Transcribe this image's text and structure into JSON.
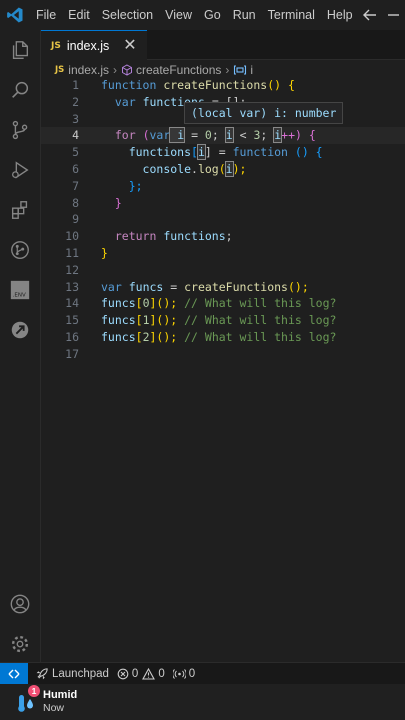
{
  "menu": [
    "File",
    "Edit",
    "Selection",
    "View",
    "Go",
    "Run",
    "Terminal",
    "Help"
  ],
  "tab": {
    "badge": "JS",
    "label": "index.js",
    "close": "✕"
  },
  "breadcrumb": {
    "file": "index.js",
    "func": "createFunctions",
    "var": "i",
    "sep": "›"
  },
  "hover": {
    "text": "(local var) i: number"
  },
  "line_numbers": [
    "1",
    "2",
    "3",
    "4",
    "5",
    "6",
    "7",
    "8",
    "9",
    "10",
    "11",
    "12",
    "13",
    "14",
    "15",
    "16",
    "17"
  ],
  "code": {
    "l1": {
      "kw": "function",
      "fn": "createFunctions",
      "rest": "() {"
    },
    "l2": {
      "kw": "var",
      "var": "functions",
      "rest": " = [];"
    },
    "l4": {
      "kw": "for",
      "a": " (",
      "kw2": "var",
      "v": " i",
      "b": " = ",
      "n0": "0",
      "c": "; ",
      "v2": "i",
      "d": " < ",
      "n3": "3",
      "e": "; ",
      "v3": "i",
      "f": "++) {"
    },
    "l5": {
      "var": "functions",
      "a": "[",
      "v": "i",
      "b": "] = ",
      "kw": "function",
      "c": " () {"
    },
    "l6": {
      "var": "console",
      "a": ".",
      "fn": "log",
      "b": "(",
      "v": "i",
      "c": ");"
    },
    "l7": "};",
    "l8": "}",
    "l10": {
      "kw": "return",
      "var": "functions",
      "rest": ";"
    },
    "l11": "}",
    "l13": {
      "kw": "var",
      "var": "funcs",
      "b": " = ",
      "fn": "createFunctions",
      "c": "();"
    },
    "l14": {
      "var": "funcs",
      "a": "[",
      "n": "0",
      "b": "](); ",
      "cmt": "// What will this log?"
    },
    "l15": {
      "var": "funcs",
      "a": "[",
      "n": "1",
      "b": "](); ",
      "cmt": "// What will this log?"
    },
    "l16": {
      "var": "funcs",
      "a": "[",
      "n": "2",
      "b": "](); ",
      "cmt": "// What will this log?"
    }
  },
  "status": {
    "launchpad": "Launchpad",
    "errors": "0",
    "warnings": "0",
    "ports": "0"
  },
  "notification": {
    "badge": "1",
    "title": "Humid",
    "subtitle": "Now"
  },
  "colors": {
    "accent": "#0078d4",
    "keyword": "#569cd6",
    "function": "#dcdcaa",
    "variable": "#9cdcfe",
    "comment": "#6a9955",
    "number": "#b5cea8"
  }
}
